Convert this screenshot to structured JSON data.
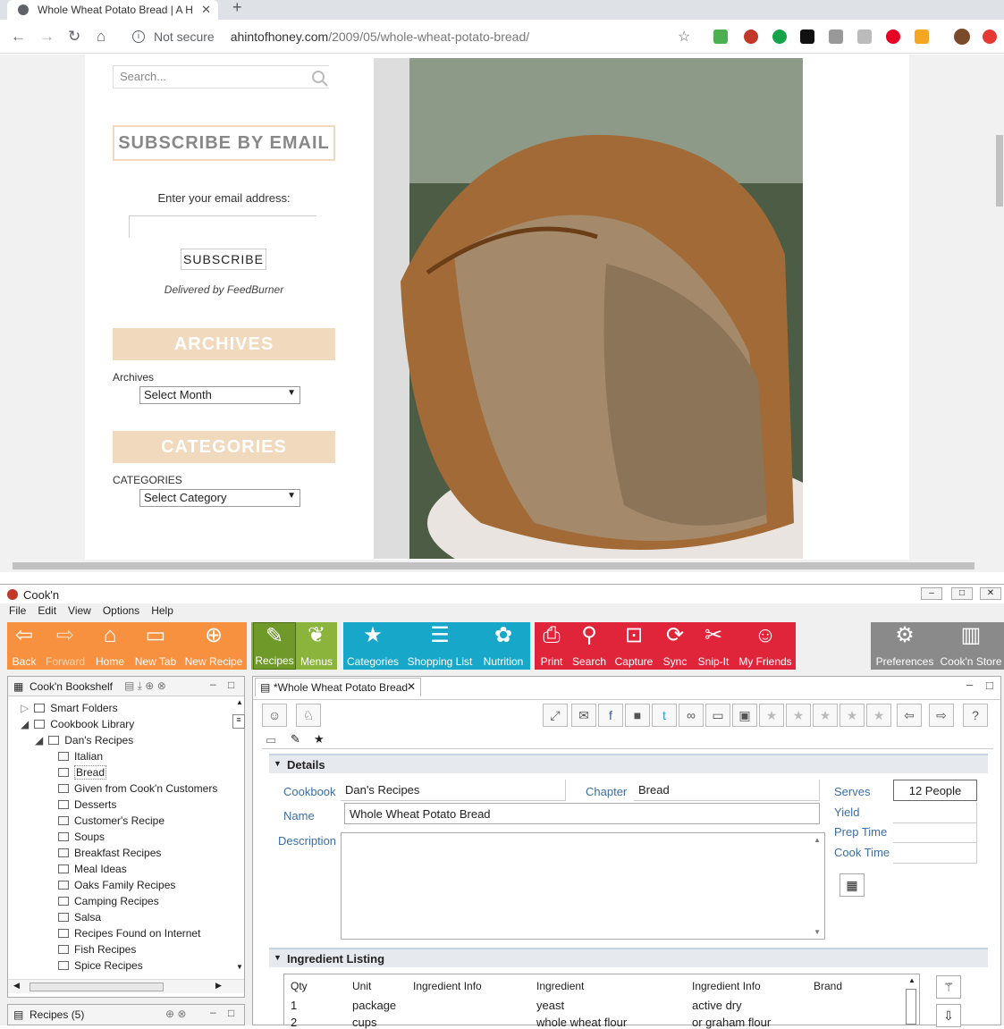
{
  "browser": {
    "tab_title": "Whole Wheat Potato Bread | A H",
    "address_security": "Not secure",
    "address_host": "ahintofhoney.com",
    "address_path": "/2009/05/whole-wheat-potato-bread/"
  },
  "webpage": {
    "search_placeholder": "Search...",
    "subscribe_heading": "SUBSCRIBE BY EMAIL",
    "email_label": "Enter your email address:",
    "subscribe_button": "SUBSCRIBE",
    "delivered_by": "Delivered by FeedBurner",
    "archives_banner": "ARCHIVES",
    "archives_label": "Archives",
    "archives_select": "Select Month",
    "categories_banner": "CATEGORIES",
    "categories_label": "CATEGORIES",
    "categories_select": "Select Category"
  },
  "app": {
    "title": "Cook'n",
    "menu": [
      "File",
      "Edit",
      "View",
      "Options",
      "Help"
    ],
    "ribbon": {
      "back": "Back",
      "forward": "Forward",
      "home": "Home",
      "new_tab": "New Tab",
      "new_recipe": "New Recipe",
      "recipes": "Recipes",
      "menus": "Menus",
      "categories": "Categories",
      "shopping_list": "Shopping List",
      "nutrition": "Nutrition",
      "print": "Print",
      "search": "Search",
      "capture": "Capture",
      "sync": "Sync",
      "snip_it": "Snip-It",
      "my_friends": "My Friends",
      "preferences": "Preferences",
      "store": "Cook'n Store"
    },
    "bookshelf": {
      "title": "Cook'n Bookshelf",
      "smart_folders": "Smart Folders",
      "library": "Cookbook Library",
      "cookbook": "Dan's Recipes",
      "chapters": [
        "Italian",
        "Bread",
        "Given from Cook'n Customers",
        "Desserts",
        "Customer's Recipe",
        "Soups",
        "Breakfast Recipes",
        "Meal Ideas",
        "Oaks Family Recipes",
        "Camping Recipes",
        "Salsa",
        "Recipes Found on Internet",
        "Fish Recipes",
        "Spice Recipes"
      ]
    },
    "recipes_pane": "Recipes (5)",
    "recipe": {
      "tab_title": "*Whole Wheat Potato Bread",
      "details_header": "Details",
      "cookbook_label": "Cookbook",
      "cookbook_value": "Dan's Recipes",
      "chapter_label": "Chapter",
      "chapter_value": "Bread",
      "name_label": "Name",
      "name_value": "Whole Wheat Potato Bread",
      "description_label": "Description",
      "serves_label": "Serves",
      "serves_value": "12 People",
      "yield_label": "Yield",
      "prep_label": "Prep Time",
      "cook_label": "Cook Time",
      "ingredients_header": "Ingredient Listing",
      "columns": [
        "Qty",
        "Unit",
        "Ingredient Info",
        "Ingredient",
        "Ingredient Info",
        "Brand"
      ],
      "rows": [
        [
          "1",
          "package",
          "",
          "yeast",
          "active dry",
          ""
        ],
        [
          "2",
          "cups",
          "",
          "whole wheat flour",
          "or graham flour",
          ""
        ]
      ]
    }
  },
  "colors": {
    "orange": "#f7913f",
    "green": "#8bb43c",
    "teal": "#17a8c9",
    "red": "#e0253a",
    "gray": "#8a8a8a",
    "banner": "#f0d9bd"
  }
}
